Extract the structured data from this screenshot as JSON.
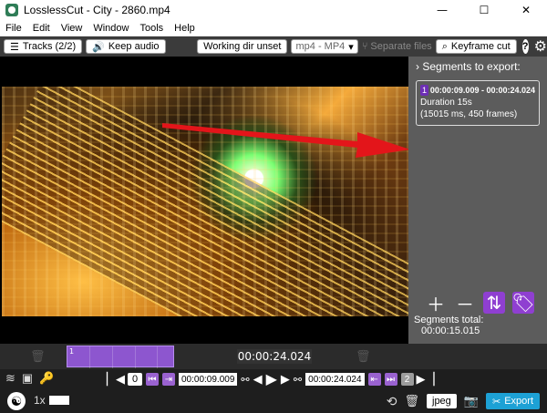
{
  "window": {
    "title": "LosslessCut - City - 2860.mp4",
    "minimize": "—",
    "maximize": "☐",
    "close": "✕"
  },
  "menu": [
    "File",
    "Edit",
    "View",
    "Window",
    "Tools",
    "Help"
  ],
  "toolbar": {
    "tracks": "Tracks (2/2)",
    "keep_audio": "Keep audio",
    "working_dir": "Working dir unset",
    "format": "mp4 - MP4",
    "separate_files": "Separate files",
    "keyframe_cut": "Keyframe cut",
    "help": "?",
    "settings_icon": "gear-icon"
  },
  "segments_panel": {
    "title": "Segments to export:",
    "segment": {
      "number": "1",
      "time_range": "00:00:09.009 - 00:00:24.024",
      "duration": "Duration 15s",
      "details": "(15015 ms, 450 frames)"
    },
    "total_label": "Segments total:",
    "total_value": "00:00:15.015"
  },
  "timeline": {
    "segment_label": "1",
    "current_time": "00:00:24.024"
  },
  "controls": {
    "start_index": "0",
    "start_time": "00:00:09.009",
    "end_time": "00:00:24.024",
    "end_index": "2"
  },
  "footer": {
    "speed": "1x",
    "jpeg": "jpeg",
    "export": "Export"
  },
  "colors": {
    "accent_purple": "#8f3fd1",
    "export_blue": "#1da1d5",
    "arrow_red": "#e3151a"
  }
}
